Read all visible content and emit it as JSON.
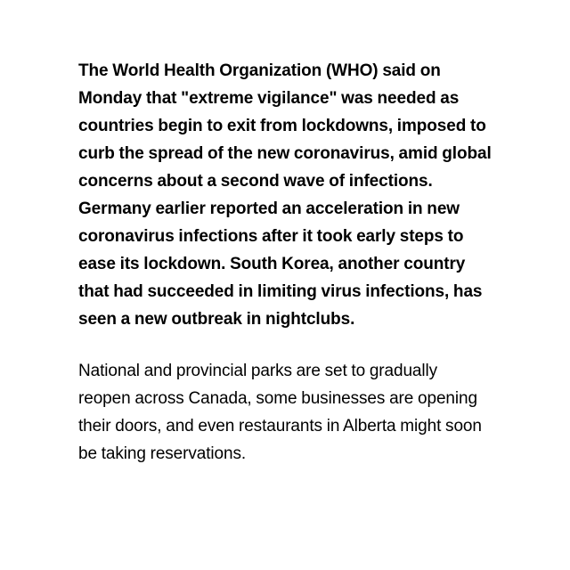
{
  "article": {
    "lead_paragraph": "The World Health Organization (WHO) said on Monday that \"extreme vigilance\" was needed as countries begin to exit from lockdowns, imposed to curb the spread of the new coronavirus, amid global concerns about a second wave of infections. Germany earlier reported an acceleration in new coronavirus infections after it took early steps to ease its lockdown. South Korea, another country that had succeeded in limiting virus infections, has seen a new outbreak in nightclubs.",
    "body_paragraph": "National and provincial parks are set to gradually reopen across Canada, some businesses are opening their doors, and even restaurants in Alberta might soon be taking reservations."
  }
}
